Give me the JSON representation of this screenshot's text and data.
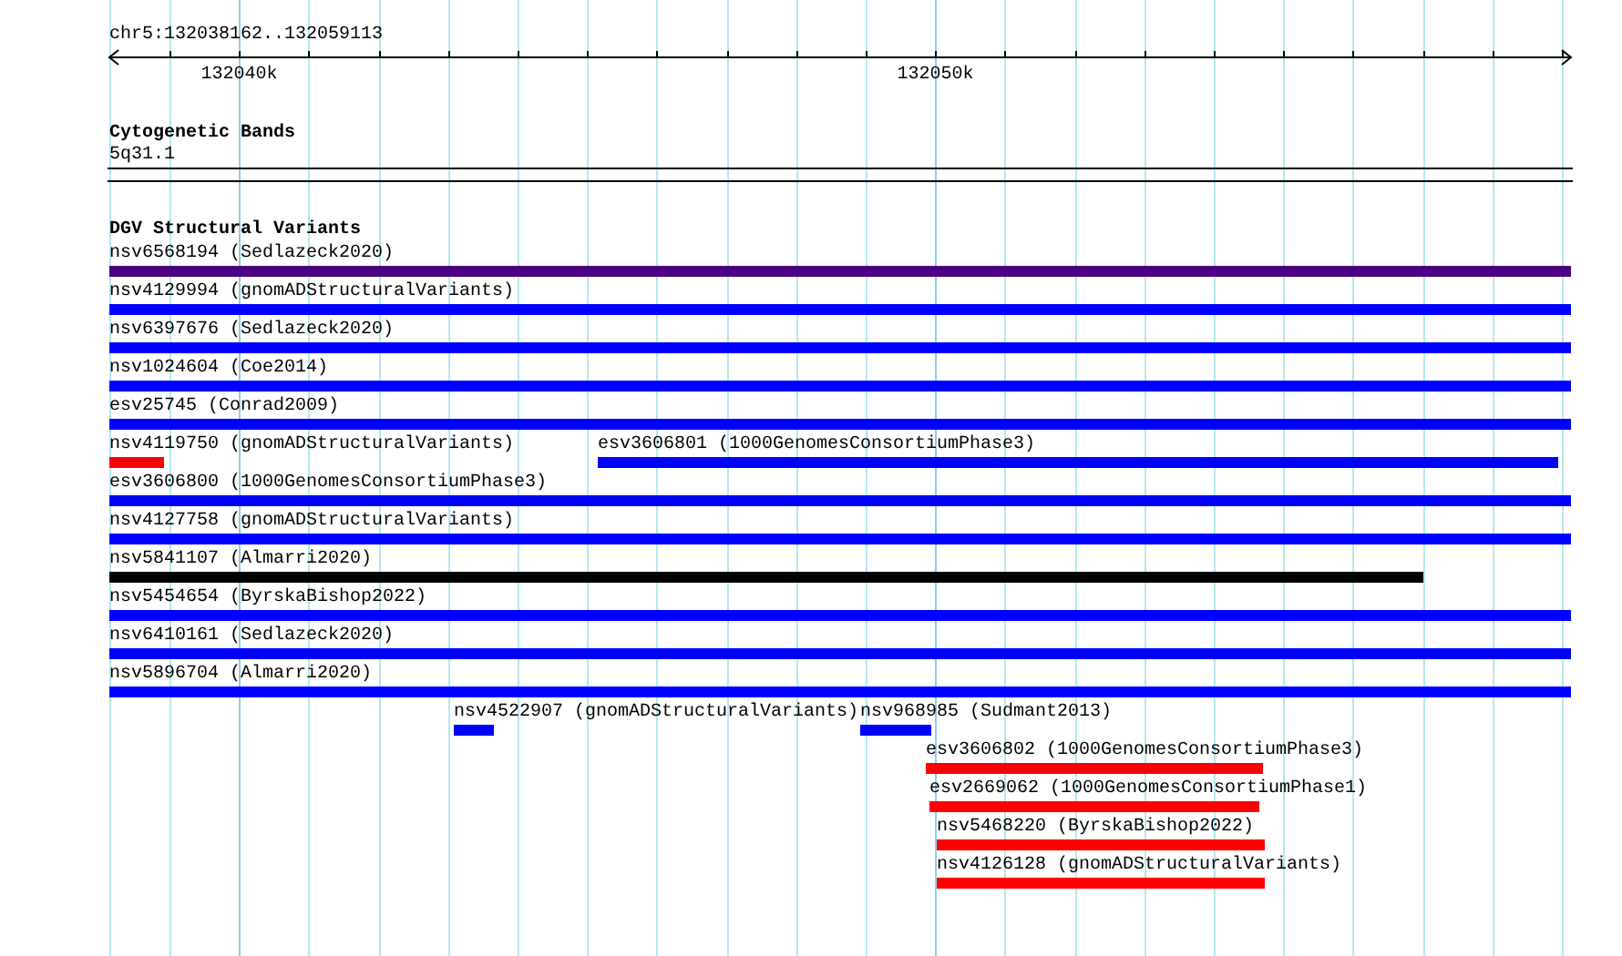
{
  "ruler": {
    "title": "chr5:132038162..132059113",
    "tick_labels": [
      "132040k",
      "132050k"
    ]
  },
  "cytogenetic_bands": {
    "title": "Cytogenetic Bands",
    "band": "5q31.1"
  },
  "dgv_track": {
    "title": "DGV Structural Variants",
    "rows": [
      [
        {
          "label": "nsv6568194 (Sedlazeck2020)",
          "color": "#4b0082"
        }
      ],
      [
        {
          "label": "nsv4129994 (gnomADStructuralVariants)",
          "color": "#0000ff"
        }
      ],
      [
        {
          "label": "nsv6397676 (Sedlazeck2020)",
          "color": "#0000ff"
        }
      ],
      [
        {
          "label": "nsv1024604 (Coe2014)",
          "color": "#0000ff"
        }
      ],
      [
        {
          "label": "esv25745 (Conrad2009)",
          "color": "#0000ff"
        }
      ],
      [
        {
          "label": "nsv4119750 (gnomADStructuralVariants)",
          "color": "#ff0000"
        },
        {
          "label": "esv3606801 (1000GenomesConsortiumPhase3)",
          "color": "#0000ff"
        }
      ],
      [
        {
          "label": "esv3606800 (1000GenomesConsortiumPhase3)",
          "color": "#0000ff"
        }
      ],
      [
        {
          "label": "nsv4127758 (gnomADStructuralVariants)",
          "color": "#0000ff"
        }
      ],
      [
        {
          "label": "nsv5841107 (Almarri2020)",
          "color": "#000000"
        }
      ],
      [
        {
          "label": "nsv5454654 (ByrskaBishop2022)",
          "color": "#0000ff"
        }
      ],
      [
        {
          "label": "nsv6410161 (Sedlazeck2020)",
          "color": "#0000ff"
        }
      ],
      [
        {
          "label": "nsv5896704 (Almarri2020)",
          "color": "#0000ff"
        }
      ],
      [
        {
          "label": "nsv4522907 (gnomADStructuralVariants)",
          "color": "#0000ff"
        },
        {
          "label": "nsv968985 (Sudmant2013)",
          "color": "#0000ff"
        }
      ],
      [
        {
          "label": "esv3606802 (1000GenomesConsortiumPhase3)",
          "color": "#ff0000"
        }
      ],
      [
        {
          "label": "esv2669062 (1000GenomesConsortiumPhase1)",
          "color": "#ff0000"
        }
      ],
      [
        {
          "label": "nsv5468220 (ByrskaBishop2022)",
          "color": "#ff0000"
        }
      ],
      [
        {
          "label": "nsv4126128 (gnomADStructuralVariants)",
          "color": "#ff0000"
        }
      ]
    ]
  }
}
